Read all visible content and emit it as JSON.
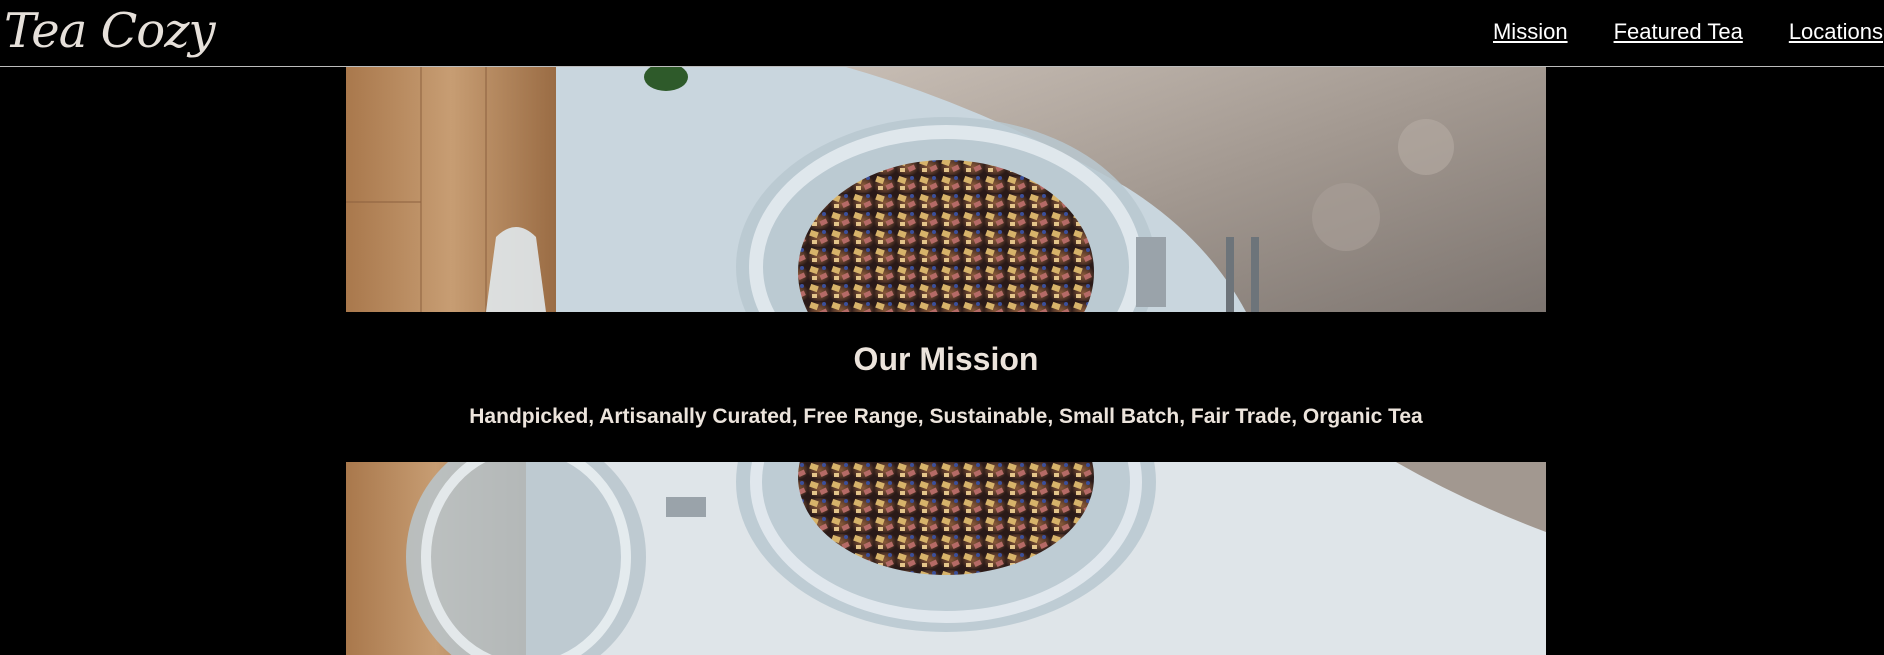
{
  "header": {
    "logo": "Tea Cozy",
    "nav": [
      {
        "label": "Mission"
      },
      {
        "label": "Featured Tea"
      },
      {
        "label": "Locations"
      }
    ]
  },
  "mission": {
    "title": "Our Mission",
    "tagline": "Handpicked, Artisanally Curated, Free Range, Sustainable, Small Batch, Fair Trade, Organic Tea"
  },
  "colors": {
    "background": "#000000",
    "text": "#ece4dc",
    "nav_link": "#ffffff"
  }
}
